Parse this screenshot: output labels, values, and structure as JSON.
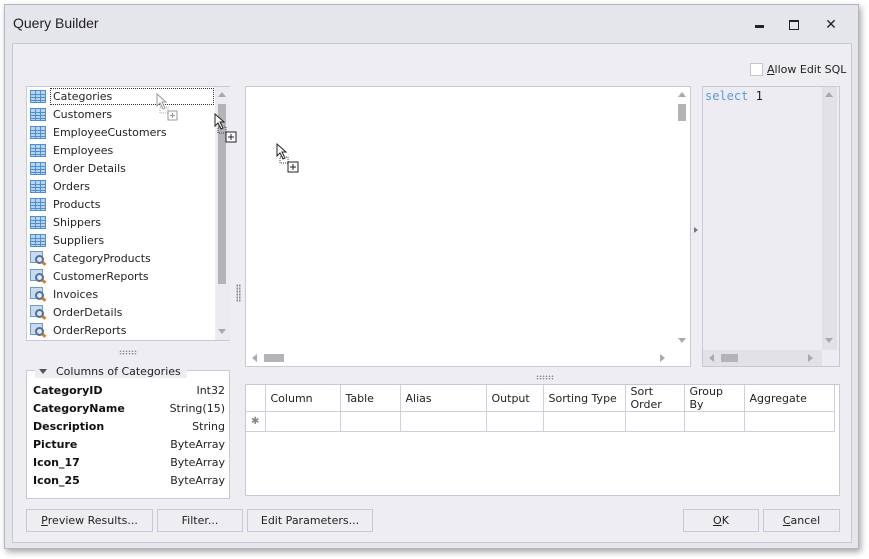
{
  "window": {
    "title": "Query Builder",
    "controls": {
      "minimize": "minimize",
      "maximize": "maximize",
      "close": "✕"
    }
  },
  "allow_edit_sql": {
    "label_first": "A",
    "label_rest": "llow Edit SQL",
    "checked": false
  },
  "tables": [
    {
      "name": "Categories",
      "kind": "table",
      "selected": true
    },
    {
      "name": "Customers",
      "kind": "table"
    },
    {
      "name": "EmployeeCustomers",
      "kind": "table"
    },
    {
      "name": "Employees",
      "kind": "table"
    },
    {
      "name": "Order Details",
      "kind": "table"
    },
    {
      "name": "Orders",
      "kind": "table"
    },
    {
      "name": "Products",
      "kind": "table"
    },
    {
      "name": "Shippers",
      "kind": "table"
    },
    {
      "name": "Suppliers",
      "kind": "table"
    },
    {
      "name": "CategoryProducts",
      "kind": "view"
    },
    {
      "name": "CustomerReports",
      "kind": "view"
    },
    {
      "name": "Invoices",
      "kind": "view"
    },
    {
      "name": "OrderDetails",
      "kind": "view"
    },
    {
      "name": "OrderReports",
      "kind": "view"
    }
  ],
  "columns_panel": {
    "title": "Columns of Categories",
    "columns": [
      {
        "name": "CategoryID",
        "type": "Int32"
      },
      {
        "name": "CategoryName",
        "type": "String(15)"
      },
      {
        "name": "Description",
        "type": "String"
      },
      {
        "name": "Picture",
        "type": "ByteArray"
      },
      {
        "name": "Icon_17",
        "type": "ByteArray"
      },
      {
        "name": "Icon_25",
        "type": "ByteArray"
      }
    ]
  },
  "sql": {
    "keyword": "select",
    "value": "1"
  },
  "grid": {
    "row_indicator": "✱",
    "headers": [
      "Column",
      "Table",
      "Alias",
      "Output",
      "Sorting Type",
      "Sort Order",
      "Group By",
      "Aggregate"
    ]
  },
  "buttons": {
    "preview_first": "P",
    "preview_rest": "review Results...",
    "filter": "Filter...",
    "edit_parameters": "Edit Parameters...",
    "ok_first": "O",
    "ok_rest": "K",
    "cancel_first": "C",
    "cancel_rest": "ancel"
  }
}
